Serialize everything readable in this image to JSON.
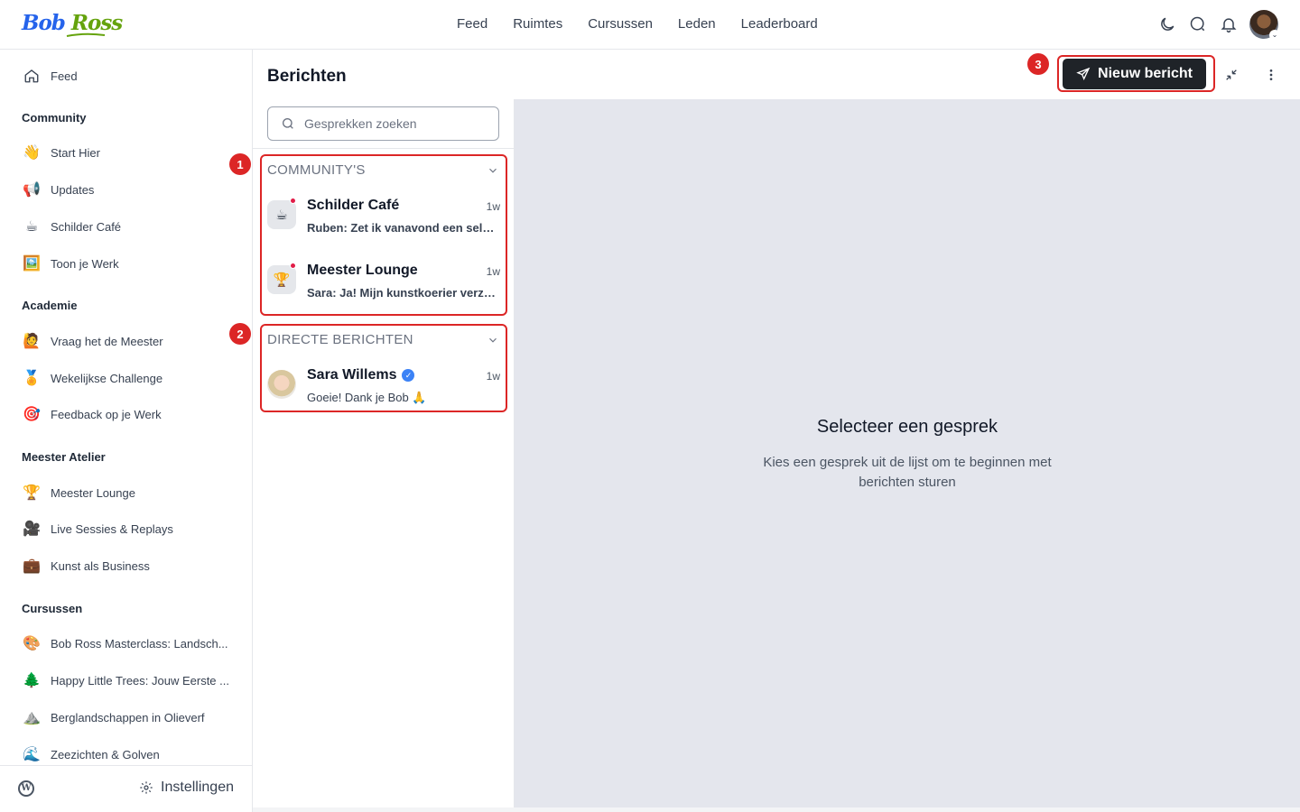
{
  "brand": {
    "logo_first": "Bob",
    "logo_second": "Ross"
  },
  "topnav": [
    "Feed",
    "Ruimtes",
    "Cursussen",
    "Leden",
    "Leaderboard"
  ],
  "top_icons": [
    "moon-icon",
    "search-icon",
    "bell-icon",
    "user-avatar"
  ],
  "sidebar": {
    "feed": "Feed",
    "sections": [
      {
        "title": "Community",
        "items": [
          {
            "label": "Start Hier",
            "icon": "👋"
          },
          {
            "label": "Updates",
            "icon": "📢"
          },
          {
            "label": "Schilder Café",
            "icon": "☕"
          },
          {
            "label": "Toon je Werk",
            "icon": "🖼️"
          }
        ]
      },
      {
        "title": "Academie",
        "items": [
          {
            "label": "Vraag het de Meester",
            "icon": "🙋"
          },
          {
            "label": "Wekelijkse Challenge",
            "icon": "🏅"
          },
          {
            "label": "Feedback op je Werk",
            "icon": "🎯"
          }
        ]
      },
      {
        "title": "Meester Atelier",
        "items": [
          {
            "label": "Meester Lounge",
            "icon": "🏆"
          },
          {
            "label": "Live Sessies & Replays",
            "icon": "🎥"
          },
          {
            "label": "Kunst als Business",
            "icon": "💼"
          }
        ]
      },
      {
        "title": "Cursussen",
        "items": [
          {
            "label": "Bob Ross Masterclass: Landsch...",
            "icon": "🎨"
          },
          {
            "label": "Happy Little Trees: Jouw Eerste ...",
            "icon": "🌲"
          },
          {
            "label": "Berglandschappen in Olieverf",
            "icon": "⛰️"
          },
          {
            "label": "Zeezichten & Golven",
            "icon": "🌊"
          }
        ]
      }
    ],
    "settings": "Instellingen"
  },
  "messages": {
    "title": "Berichten",
    "new_message": "Nieuw bericht",
    "search_placeholder": "Gesprekken zoeken",
    "groups": [
      {
        "title": "COMMUNITY'S",
        "badge": "1",
        "conversations": [
          {
            "name": "Schilder Café",
            "icon": "☕",
            "time": "1w",
            "preview": "Ruben: Zet ik vanavond een selectie klaar",
            "unread": true
          },
          {
            "name": "Meester Lounge",
            "icon": "🏆",
            "time": "1w",
            "preview": "Sara: Ja! Mijn kunstkoerier verzorgt het",
            "unread": true
          }
        ]
      },
      {
        "title": "DIRECTE BERICHTEN",
        "badge": "2",
        "conversations": [
          {
            "name": "Sara Willems",
            "time": "1w",
            "preview": "Goeie! Dank je Bob 🙏",
            "verified": true
          }
        ]
      }
    ],
    "new_message_badge": "3",
    "empty_title": "Selecteer een gesprek",
    "empty_sub": "Kies een gesprek uit de lijst om te beginnen met berichten sturen"
  },
  "colors": {
    "accent": "#dc2626",
    "button": "#1f2328",
    "pane_bg": "#e4e6ed",
    "unread_dot": "#e11d48"
  }
}
